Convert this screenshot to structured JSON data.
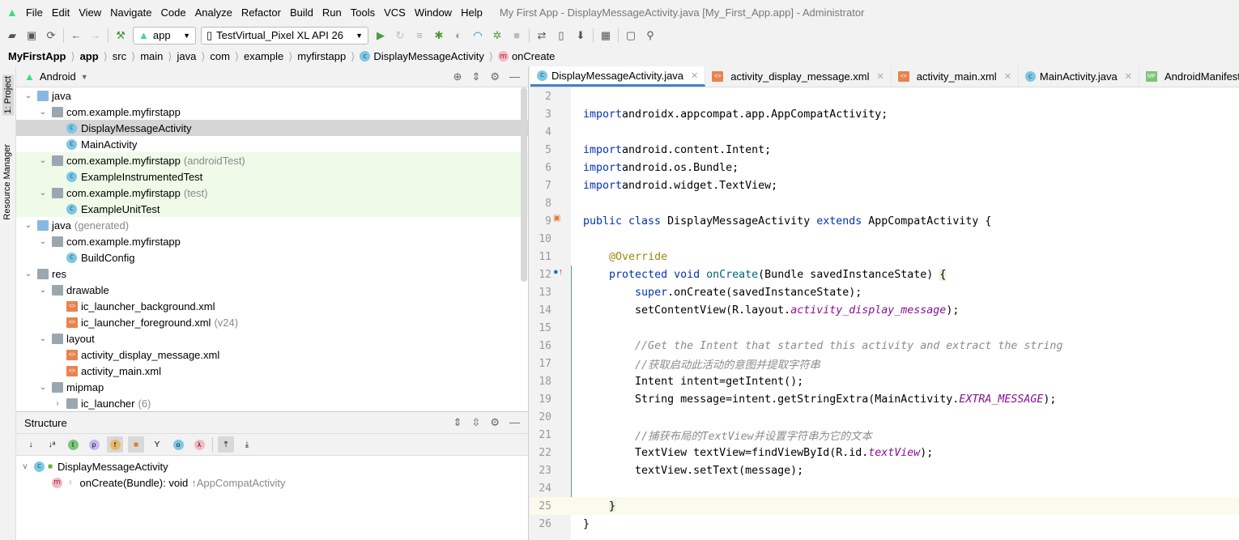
{
  "menu": {
    "items": [
      "File",
      "Edit",
      "View",
      "Navigate",
      "Code",
      "Analyze",
      "Refactor",
      "Build",
      "Run",
      "Tools",
      "VCS",
      "Window",
      "Help"
    ],
    "window_title": "My First App - DisplayMessageActivity.java [My_First_App.app] - Administrator"
  },
  "toolbar": {
    "module": "app",
    "device": "TestVirtual_Pixel XL API 26"
  },
  "breadcrumb": [
    "MyFirstApp",
    "app",
    "src",
    "main",
    "java",
    "com",
    "example",
    "myfirstapp",
    "DisplayMessageActivity",
    "onCreate"
  ],
  "side_tabs": {
    "project": "1: Project",
    "resource": "Resource Manager"
  },
  "project": {
    "view": "Android",
    "rows": [
      {
        "level": 1,
        "arrow": "v",
        "icon": "folder-blue",
        "label": "java"
      },
      {
        "level": 2,
        "arrow": "v",
        "icon": "folder",
        "label": "com.example.myfirstapp"
      },
      {
        "level": 3,
        "arrow": "",
        "icon": "class",
        "label": "DisplayMessageActivity",
        "state": "selected"
      },
      {
        "level": 3,
        "arrow": "",
        "icon": "class",
        "label": "MainActivity"
      },
      {
        "level": 2,
        "arrow": "v",
        "icon": "folder",
        "label": "com.example.myfirstapp",
        "suffix": "(androidTest)",
        "state": "test"
      },
      {
        "level": 3,
        "arrow": "",
        "icon": "class",
        "label": "ExampleInstrumentedTest",
        "state": "test"
      },
      {
        "level": 2,
        "arrow": "v",
        "icon": "folder",
        "label": "com.example.myfirstapp",
        "suffix": "(test)",
        "state": "test"
      },
      {
        "level": 3,
        "arrow": "",
        "icon": "class",
        "label": "ExampleUnitTest",
        "state": "test"
      },
      {
        "level": 1,
        "arrow": "v",
        "icon": "folder-gen",
        "label": "java",
        "suffix": "(generated)"
      },
      {
        "level": 2,
        "arrow": "v",
        "icon": "folder",
        "label": "com.example.myfirstapp"
      },
      {
        "level": 3,
        "arrow": "",
        "icon": "class",
        "label": "BuildConfig"
      },
      {
        "level": 1,
        "arrow": "v",
        "icon": "folder",
        "label": "res"
      },
      {
        "level": 2,
        "arrow": "v",
        "icon": "folder",
        "label": "drawable"
      },
      {
        "level": 3,
        "arrow": "",
        "icon": "xml",
        "label": "ic_launcher_background.xml"
      },
      {
        "level": 3,
        "arrow": "",
        "icon": "xml",
        "label": "ic_launcher_foreground.xml",
        "suffix": "(v24)"
      },
      {
        "level": 2,
        "arrow": "v",
        "icon": "folder",
        "label": "layout"
      },
      {
        "level": 3,
        "arrow": "",
        "icon": "xml",
        "label": "activity_display_message.xml"
      },
      {
        "level": 3,
        "arrow": "",
        "icon": "xml",
        "label": "activity_main.xml"
      },
      {
        "level": 2,
        "arrow": "v",
        "icon": "folder",
        "label": "mipmap"
      },
      {
        "level": 3,
        "arrow": ">",
        "icon": "folder",
        "label": "ic_launcher",
        "suffix": "(6)"
      }
    ]
  },
  "structure": {
    "title": "Structure",
    "class_name": "DisplayMessageActivity",
    "method": "onCreate(Bundle): void",
    "method_origin": "↑AppCompatActivity"
  },
  "tabs": [
    {
      "label": "DisplayMessageActivity.java",
      "icon": "class",
      "active": true
    },
    {
      "label": "activity_display_message.xml",
      "icon": "xml"
    },
    {
      "label": "activity_main.xml",
      "icon": "xml"
    },
    {
      "label": "MainActivity.java",
      "icon": "class"
    },
    {
      "label": "AndroidManifest.xml",
      "icon": "manifest"
    }
  ],
  "code": [
    {
      "n": "2",
      "t": []
    },
    {
      "n": "3",
      "t": [
        [
          "kw",
          "import"
        ],
        [
          "",
          "androidx.appcompat.app.AppCompatActivity;"
        ]
      ]
    },
    {
      "n": "4",
      "t": []
    },
    {
      "n": "5",
      "t": [
        [
          "kw",
          "import"
        ],
        [
          "",
          "android.content.Intent;"
        ]
      ]
    },
    {
      "n": "6",
      "t": [
        [
          "kw",
          "import"
        ],
        [
          "",
          "android.os.Bundle;"
        ]
      ]
    },
    {
      "n": "7",
      "t": [
        [
          "kw",
          "import"
        ],
        [
          "",
          "android.widget.TextView;"
        ]
      ]
    },
    {
      "n": "8",
      "t": []
    },
    {
      "n": "9",
      "t": [
        [
          "kw",
          "public class "
        ],
        [
          "",
          "DisplayMessageActivity "
        ],
        [
          "kw",
          "extends "
        ],
        [
          "",
          "AppCompatActivity {"
        ]
      ]
    },
    {
      "n": "10",
      "t": []
    },
    {
      "n": "11",
      "t": [
        [
          "",
          "    "
        ],
        [
          "an",
          "@Override"
        ]
      ]
    },
    {
      "n": "12",
      "t": [
        [
          "",
          "    "
        ],
        [
          "kw",
          "protected void "
        ],
        [
          "fn",
          "onCreate"
        ],
        [
          "",
          "(Bundle savedInstanceState) "
        ],
        [
          "br",
          "{"
        ]
      ]
    },
    {
      "n": "13",
      "t": [
        [
          "",
          "        "
        ],
        [
          "kw",
          "super"
        ],
        [
          "",
          ".onCreate(savedInstanceState);"
        ]
      ]
    },
    {
      "n": "14",
      "t": [
        [
          "",
          "        setContentView(R.layout."
        ],
        [
          "pu",
          "activity_display_message"
        ],
        [
          "",
          ");"
        ]
      ]
    },
    {
      "n": "15",
      "t": []
    },
    {
      "n": "16",
      "t": [
        [
          "",
          "        "
        ],
        [
          "cm",
          "//Get the Intent that started this activity and extract the string"
        ]
      ]
    },
    {
      "n": "17",
      "t": [
        [
          "",
          "        "
        ],
        [
          "cm",
          "//获取启动此活动的意图并提取字符串"
        ]
      ]
    },
    {
      "n": "18",
      "t": [
        [
          "",
          "        Intent intent=getIntent();"
        ]
      ]
    },
    {
      "n": "19",
      "t": [
        [
          "",
          "        String message=intent.getStringExtra(MainActivity."
        ],
        [
          "pu",
          "EXTRA_MESSAGE"
        ],
        [
          "",
          ");"
        ]
      ]
    },
    {
      "n": "20",
      "t": []
    },
    {
      "n": "21",
      "t": [
        [
          "",
          "        "
        ],
        [
          "cm",
          "//捕获布局的TextView并设置字符串为它的文本"
        ]
      ]
    },
    {
      "n": "22",
      "t": [
        [
          "",
          "        TextView textView=findViewById(R.id."
        ],
        [
          "pu",
          "textView"
        ],
        [
          "",
          ");"
        ]
      ]
    },
    {
      "n": "23",
      "t": [
        [
          "",
          "        textView.setText(message);"
        ]
      ]
    },
    {
      "n": "24",
      "t": []
    },
    {
      "n": "25",
      "t": [
        [
          "",
          "    "
        ],
        [
          "br",
          "}"
        ]
      ],
      "hl": true
    },
    {
      "n": "26",
      "t": [
        [
          "",
          "}"
        ]
      ]
    }
  ]
}
